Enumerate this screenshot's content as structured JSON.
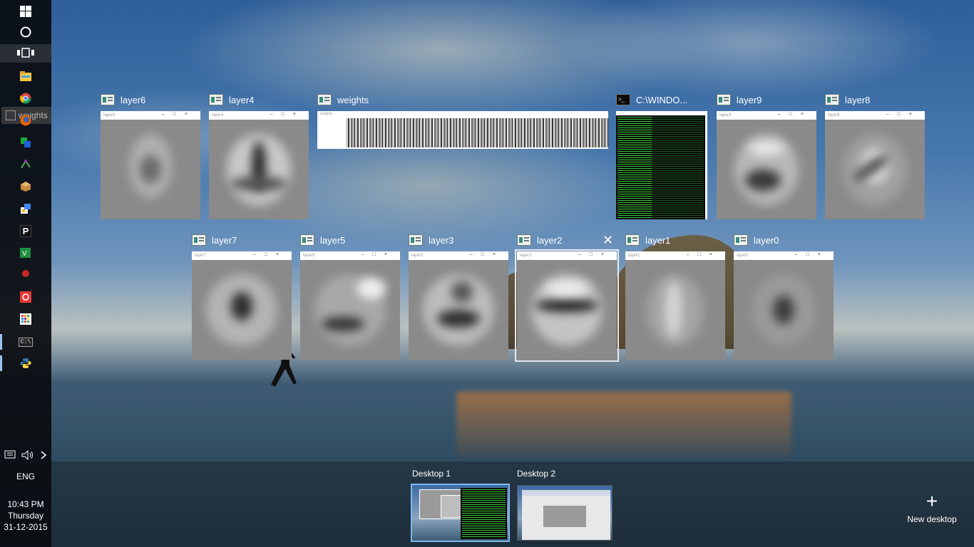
{
  "taskbar": {
    "icons": [
      "windows-start-icon",
      "cortana-icon",
      "task-view-icon",
      "file-explorer-icon",
      "chrome-icon",
      "firefox-icon",
      "app-green-blue-icon",
      "app-molecule-icon",
      "app-cube-icon",
      "app-paint-icon",
      "pycharm-icon",
      "excel-icon",
      "app-red-dot-icon",
      "app-red-icon",
      "app-grid-icon",
      "cmd-icon",
      "python-icon"
    ],
    "tooltip": "weights",
    "language": "ENG",
    "time": "10:43 PM",
    "day": "Thursday",
    "date": "31-12-2015"
  },
  "windows_row1": [
    {
      "title": "layer6",
      "inner": "layer6"
    },
    {
      "title": "layer4",
      "inner": "layer4"
    },
    {
      "title": "weights",
      "inner": "weights"
    },
    {
      "title": "C:\\WINDO...",
      "inner": ""
    },
    {
      "title": "layer9",
      "inner": "layer9"
    },
    {
      "title": "layer8",
      "inner": "layer8"
    }
  ],
  "windows_row2": [
    {
      "title": "layer7",
      "inner": "layer7"
    },
    {
      "title": "layer5",
      "inner": "layer5"
    },
    {
      "title": "layer3",
      "inner": "layer3"
    },
    {
      "title": "layer2",
      "inner": "layer2"
    },
    {
      "title": "layer1",
      "inner": "layer1"
    },
    {
      "title": "layer0",
      "inner": "layer0"
    }
  ],
  "desktops": [
    {
      "label": "Desktop 1",
      "active": true
    },
    {
      "label": "Desktop 2",
      "active": false
    }
  ],
  "new_desktop_label": "New desktop",
  "colors": {
    "taskbar_bg": "#0a0c10",
    "cmd_text": "#3cdc3c",
    "active_indicator": "#9cc3ee"
  }
}
